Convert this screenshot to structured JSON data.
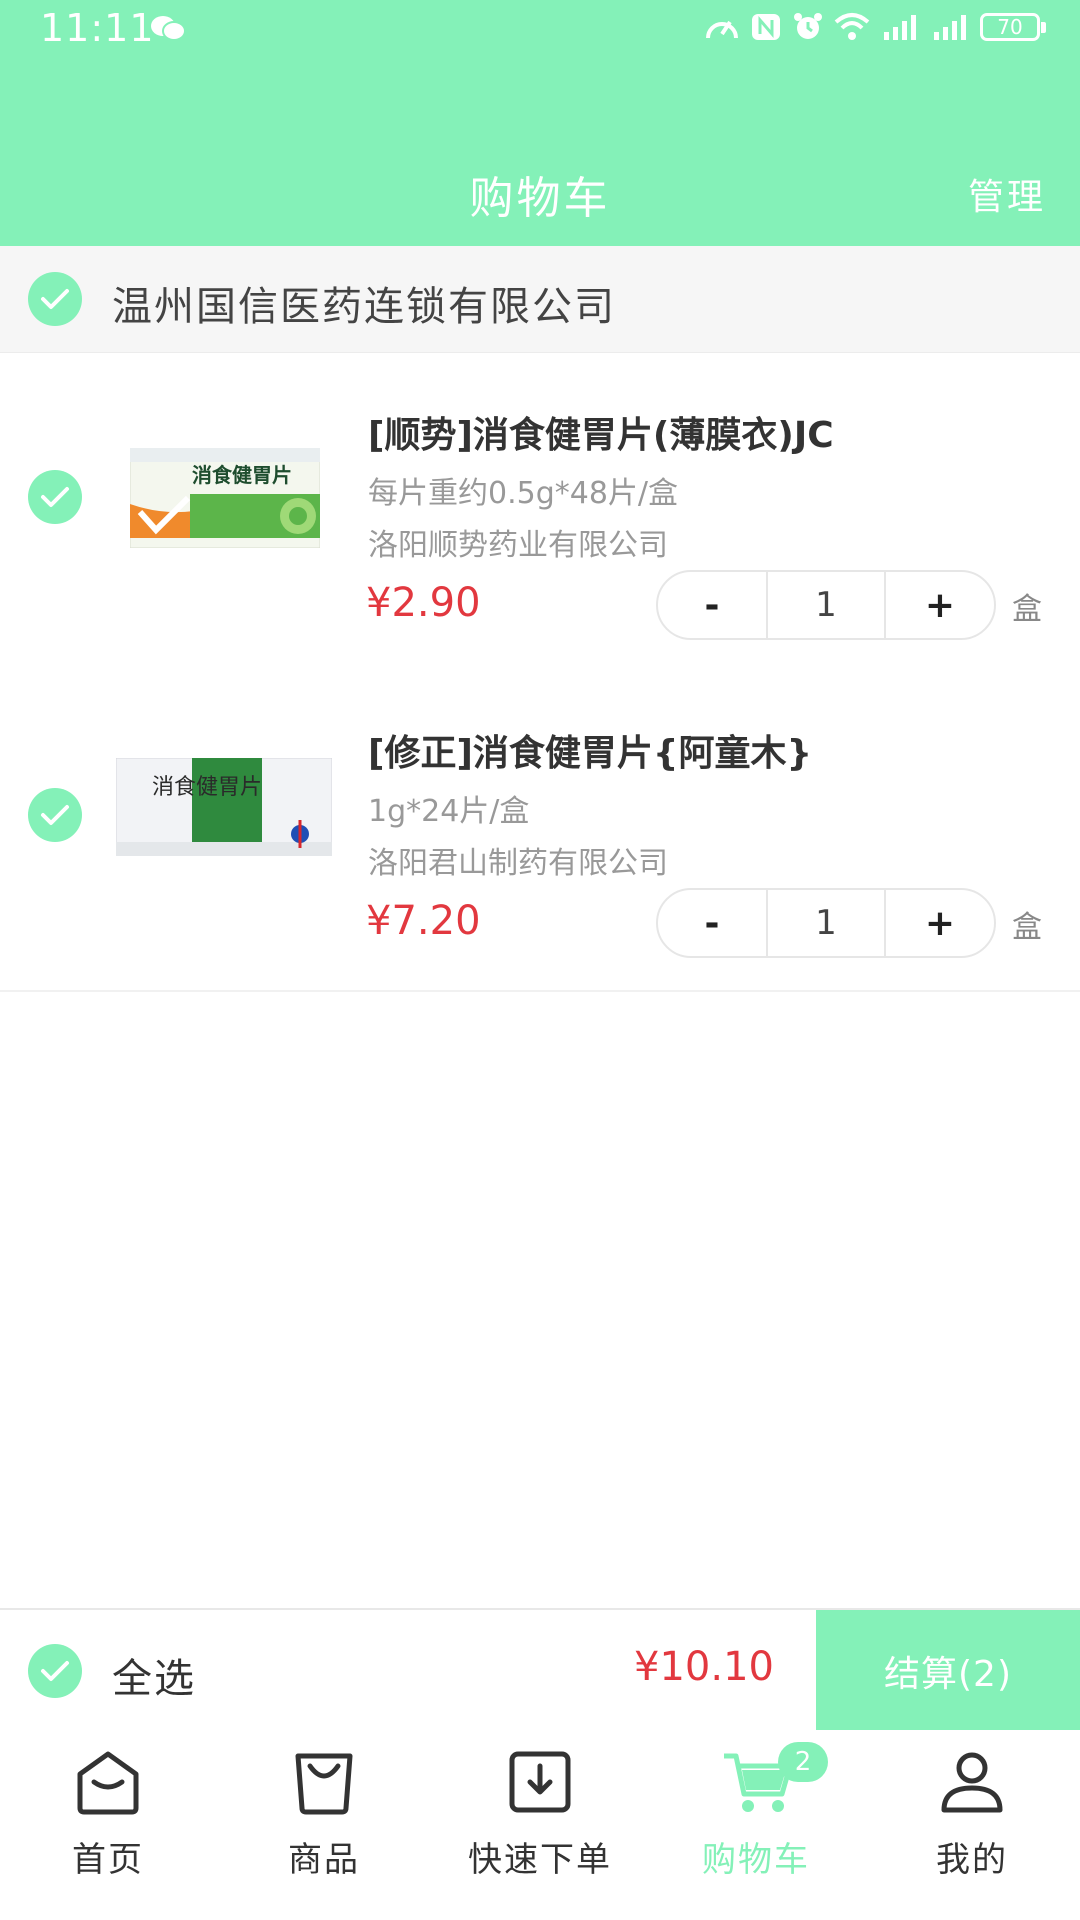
{
  "status_bar": {
    "time": "11:11",
    "battery": "70"
  },
  "header": {
    "title": "购物车",
    "manage_label": "管理"
  },
  "store": {
    "name": "温州国信医药连锁有限公司"
  },
  "items": [
    {
      "name": "[顺势]消食健胃片(薄膜衣)JC",
      "spec": "每片重约0.5g*48片/盒",
      "maker": "洛阳顺势药业有限公司",
      "price": "¥2.90",
      "quantity": "1",
      "unit": "盒",
      "box_text": "消食健胃片"
    },
    {
      "name": "[修正]消食健胃片{阿童木}",
      "spec": "1g*24片/盒",
      "maker": "洛阳君山制药有限公司",
      "price": "¥7.20",
      "quantity": "1",
      "unit": "盒",
      "box_text": "消食健胃片"
    }
  ],
  "stepper": {
    "minus": "-",
    "plus": "+"
  },
  "footer": {
    "select_all": "全选",
    "total": "¥10.10",
    "checkout": "结算(2)"
  },
  "tabs": [
    {
      "label": "首页",
      "icon": "home-icon"
    },
    {
      "label": "商品",
      "icon": "shopping-bag-icon"
    },
    {
      "label": "快速下单",
      "icon": "download-icon"
    },
    {
      "label": "购物车",
      "icon": "cart-icon",
      "badge": "2",
      "active": true
    },
    {
      "label": "我的",
      "icon": "user-icon"
    }
  ],
  "colors": {
    "accent": "#84f1b8",
    "price": "#e2383f"
  }
}
